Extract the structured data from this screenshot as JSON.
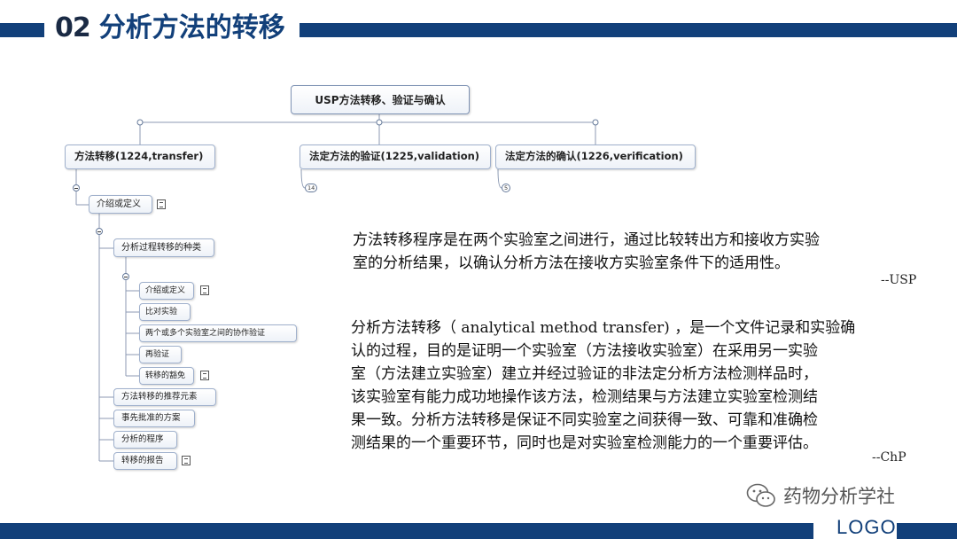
{
  "header": {
    "number": "02",
    "title": "分析方法的转移"
  },
  "mindmap": {
    "root": "USP方法转移、验证与确认",
    "transfer": "方法转移(1224,transfer)",
    "validation": "法定方法的验证(1225,validation)",
    "verification": "法定方法的确认(1226,verification)",
    "validation_count": "14",
    "verification_count": "5",
    "intro": "介绍或定义",
    "kinds": "分析过程转移的种类",
    "kinds_children": [
      "介绍或定义",
      "比对实验",
      "两个或多个实验室之间的协作验证",
      "再验证",
      "转移的豁免"
    ],
    "recommended": "方法转移的推荐元素",
    "preapproved": "事先批准的方案",
    "procedure": "分析的程序",
    "report": "转移的报告"
  },
  "quotes": {
    "usp_text": "方法转移程序是在两个实验室之间进行，通过比较转出方和接收方实验\n室的分析结果，以确认分析方法在接收方实验室条件下的适用性。",
    "usp_source": "--USP",
    "chp_text": "分析方法转移（ analytical method transfer) ，是一个文件记录和实验确\n认的过程，目的是证明一个实验室（方法接收实验室）在采用另一实验\n室（方法建立实验室）建立并经过验证的非法定分析方法检测样品时，\n该实验室有能力成功地操作该方法，检测结果与方法建立实验室检测结\n果一致。分析方法转移是保证不同实验室之间获得一致、可靠和准确检\n测结果的一个重要环节，同时也是对实验室检测能力的一个重要评估。",
    "chp_source": "--ChP"
  },
  "watermark": {
    "account": "药物分析学社",
    "icon": "wechat-icon"
  },
  "footer": {
    "logo": "LOGO"
  },
  "colors": {
    "brand": "#12407a",
    "node_border": "#9fb0cc"
  }
}
